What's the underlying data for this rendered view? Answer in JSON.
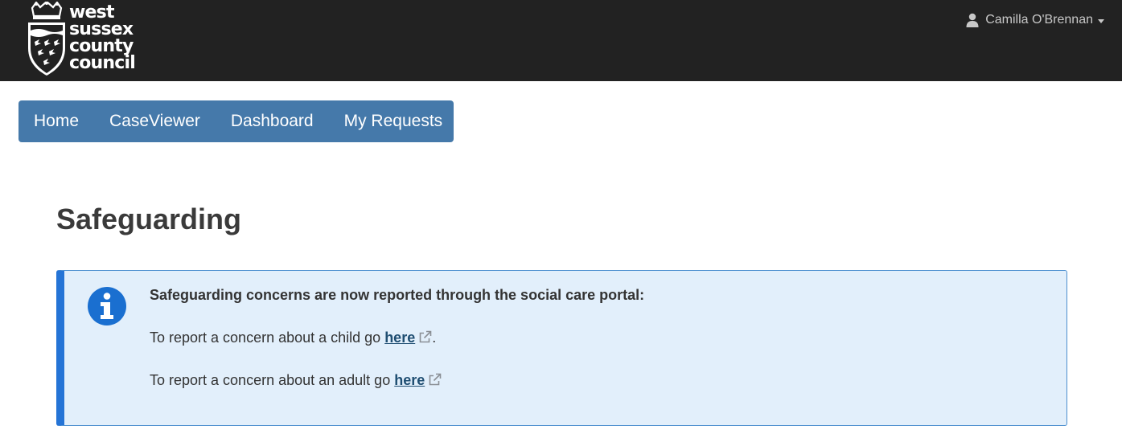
{
  "brand": {
    "logo_lines": [
      "west",
      "sussex",
      "county",
      "council"
    ]
  },
  "user_menu": {
    "icon": "user-icon",
    "name": "Camilla O'Brennan"
  },
  "nav": {
    "items": [
      {
        "label": "Home"
      },
      {
        "label": "CaseViewer"
      },
      {
        "label": "Dashboard"
      },
      {
        "label": "My Requests"
      }
    ]
  },
  "page": {
    "title": "Safeguarding"
  },
  "alert": {
    "icon": "info-circle-icon",
    "heading": "Safeguarding concerns are now reported through the social care portal:",
    "child_text": "To report a concern about a child go ",
    "child_link": "here",
    "child_suffix": ".",
    "adult_text": "To report a concern about an adult go ",
    "adult_link": "here",
    "adult_suffix": ""
  },
  "colors": {
    "topbar": "#222222",
    "nav": "#4579aa",
    "alert_background": "#e2effb",
    "alert_accent": "#2574d6",
    "link": "#1f4e72"
  }
}
